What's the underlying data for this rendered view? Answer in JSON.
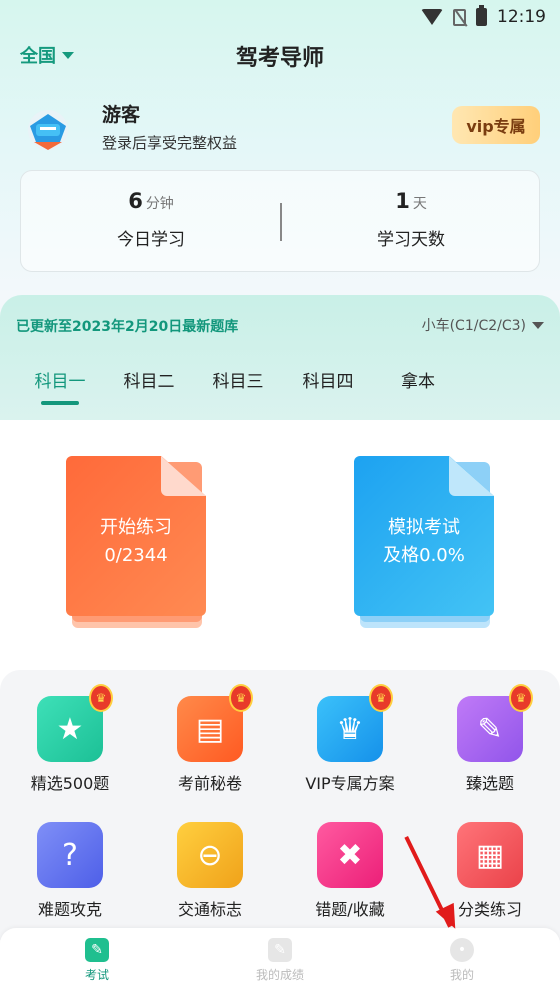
{
  "status_bar": {
    "time": "12:19"
  },
  "header": {
    "region": "全国",
    "title": "驾考导师"
  },
  "user": {
    "name": "游客",
    "subtitle": "登录后享受完整权益",
    "vip_button": "vip专属"
  },
  "stats": {
    "today": {
      "value": "6",
      "unit": "分钟",
      "label": "今日学习"
    },
    "days": {
      "value": "1",
      "unit": "天",
      "label": "学习天数"
    }
  },
  "subject": {
    "update_text": "已更新至2023年2月20日最新题库",
    "car_type": "小车(C1/C2/C3)",
    "tabs": [
      {
        "label": "科目一"
      },
      {
        "label": "科目二"
      },
      {
        "label": "科目三"
      },
      {
        "label": "科目四"
      },
      {
        "label": "拿本"
      }
    ]
  },
  "cards": {
    "practice": {
      "title": "开始练习",
      "progress": "0/2344"
    },
    "exam": {
      "title": "模拟考试",
      "pass_rate": "及格0.0%"
    }
  },
  "grid": [
    {
      "label": "精选500题",
      "icon": "star-icon",
      "color": "#2ccfa8"
    },
    {
      "label": "考前秘卷",
      "icon": "scroll-icon",
      "color": "#ff6b32"
    },
    {
      "label": "VIP专属方案",
      "icon": "crown-icon",
      "color": "#1ea6f2"
    },
    {
      "label": "臻选题",
      "icon": "edit-icon",
      "color": "#a565f0"
    },
    {
      "label": "难题攻克",
      "icon": "lightbulb-icon",
      "color": "#5b6ff0"
    },
    {
      "label": "交通标志",
      "icon": "sign-icon",
      "color": "#f6b21f"
    },
    {
      "label": "错题/收藏",
      "icon": "notebook-icon",
      "color": "#f33a8a"
    },
    {
      "label": "分类练习",
      "icon": "category-icon",
      "color": "#f25a5f"
    }
  ],
  "bottom_nav": [
    {
      "label": "考试",
      "icon": "pencil-icon"
    },
    {
      "label": "我的成绩",
      "icon": "report-icon"
    },
    {
      "label": "我的",
      "icon": "profile-icon"
    }
  ]
}
